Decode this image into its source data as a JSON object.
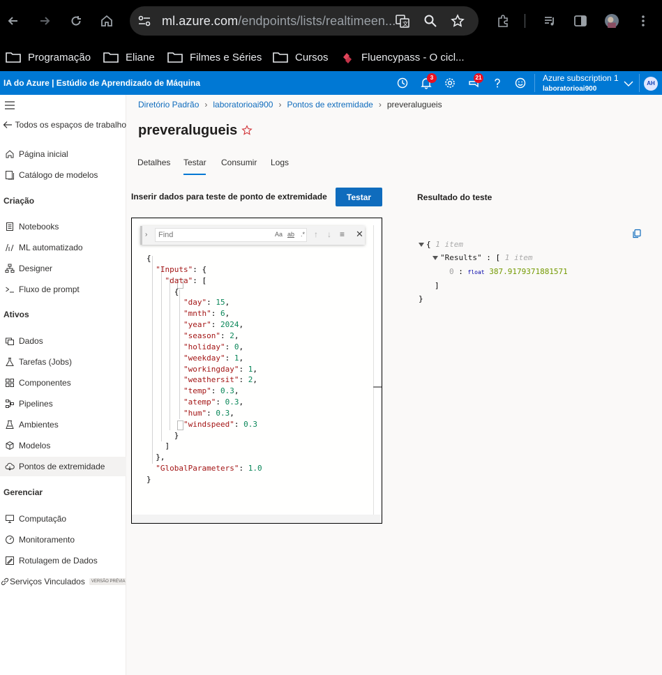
{
  "browser": {
    "url_host": "ml.azure.com",
    "url_path": "/endpoints/lists/realtimeen...",
    "bookmarks": [
      "Programação",
      "Eliane",
      "Filmes e Séries",
      "Cursos",
      "Fluencypass - O cicl..."
    ]
  },
  "azure_bar": {
    "title": "IA do Azure | Estúdio de Aprendizado de Máquina",
    "notifications_count": "3",
    "feedback_count": "21",
    "subscription": "Azure subscription 1",
    "workspace": "laboratorioai900",
    "avatar_initials": "AH"
  },
  "sidebar": {
    "back_label": "Todos os espaços de trabalho",
    "top_items": [
      "Página inicial",
      "Catálogo de modelos"
    ],
    "section_criacao": "Criação",
    "criacao_items": [
      "Notebooks",
      "ML automatizado",
      "Designer",
      "Fluxo de prompt"
    ],
    "section_ativos": "Ativos",
    "ativos_items": [
      "Dados",
      "Tarefas (Jobs)",
      "Componentes",
      "Pipelines",
      "Ambientes",
      "Modelos",
      "Pontos de extremidade"
    ],
    "section_gerenciar": "Gerenciar",
    "gerenciar_items": [
      "Computação",
      "Monitoramento",
      "Rotulagem de Dados",
      "Serviços Vinculados"
    ],
    "preview_tag": "VERSÃO PRÉVIA"
  },
  "breadcrumb": [
    "Diretório Padrão",
    "laboratorioai900",
    "Pontos de extremidade",
    "preveralugueis"
  ],
  "page_title": "preveralugueis",
  "tabs": [
    "Detalhes",
    "Testar",
    "Consumir",
    "Logs"
  ],
  "active_tab": "Testar",
  "input_heading": "Inserir dados para teste de ponto de extremidade",
  "test_button": "Testar",
  "result_heading": "Resultado do teste",
  "find_widget": {
    "placeholder": "Find",
    "opt_case": "Aa",
    "opt_word": "ab",
    "opt_regex": ".*"
  },
  "code_lines": [
    "{",
    "  \"Inputs\": {",
    "    \"data\": [",
    "      {",
    "        \"day\": 15,",
    "        \"mnth\": 6,",
    "        \"year\": 2024,",
    "        \"season\": 2,",
    "        \"holiday\": 0,",
    "        \"weekday\": 1,",
    "        \"workingday\": 1,",
    "        \"weathersit\": 2,",
    "        \"temp\": 0.3,",
    "        \"atemp\": 0.3,",
    "        \"hum\": 0.3,",
    "        \"windspeed\": 0.3",
    "      }",
    "    ]",
    "  },",
    "  \"GlobalParameters\": 1.0",
    "}"
  ],
  "result": {
    "root_count": "1 item",
    "key": "\"Results\"",
    "results_count": "1 item",
    "index": "0",
    "type": "float",
    "value": "387.9179371881571"
  }
}
